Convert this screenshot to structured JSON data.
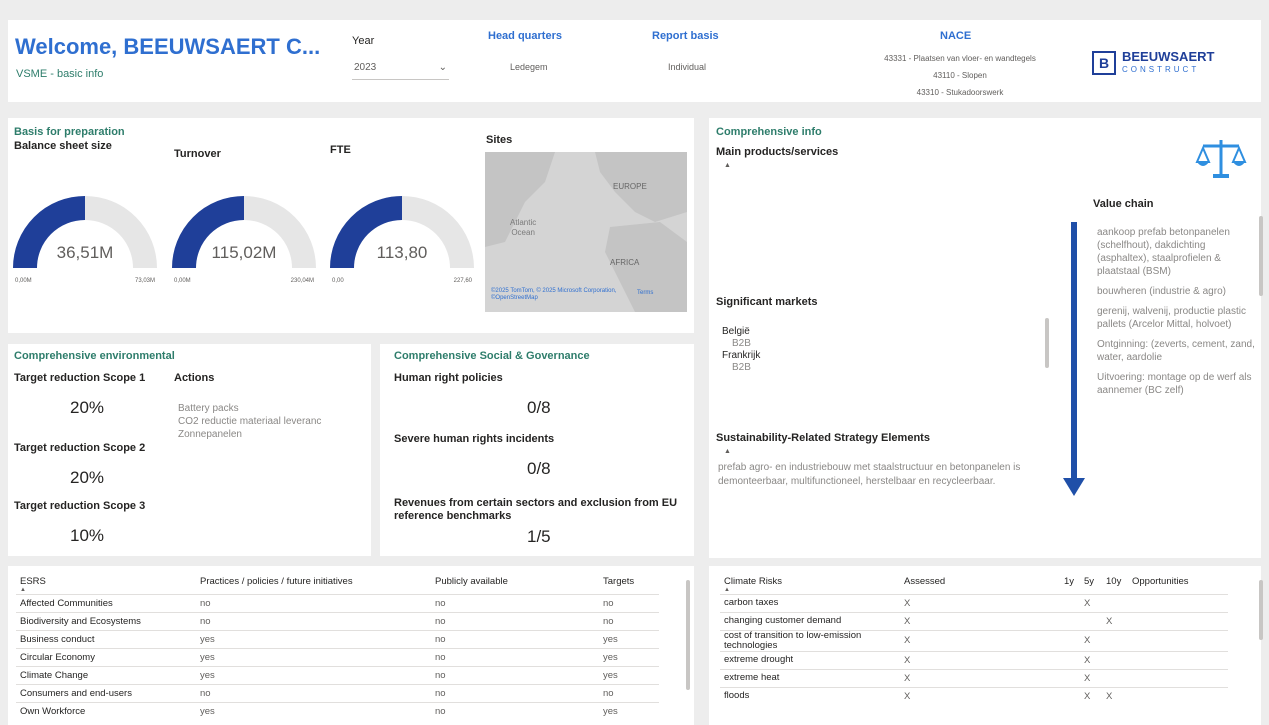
{
  "header": {
    "title": "Welcome, BEEUWSAERT C...",
    "subtitle": "VSME - basic info",
    "year_label": "Year",
    "year_value": "2023",
    "hq_label": "Head quarters",
    "hq_value": "Ledegem",
    "report_basis_label": "Report basis",
    "report_basis_value": "Individual",
    "nace_label": "NACE",
    "nace_values": [
      "43331 - Plaatsen van vloer- en wandtegels",
      "43110 - Slopen",
      "43310 - Stukadoorswerk"
    ],
    "logo_letter": "B",
    "logo_name": "BEEUWSAERT",
    "logo_sub": "CONSTRUCT"
  },
  "basis": {
    "title": "Basis for preparation",
    "sites_label": "Sites",
    "gauges": [
      {
        "label": "Balance sheet size",
        "value": "36,51M",
        "min": "0,00M",
        "max": "73,03M",
        "fraction": 0.5
      },
      {
        "label": "Turnover",
        "value": "115,02M",
        "min": "0,00M",
        "max": "230,04M",
        "fraction": 0.5
      },
      {
        "label": "FTE",
        "value": "113,80",
        "min": "0,00",
        "max": "227,60",
        "fraction": 0.5
      }
    ],
    "map_labels": {
      "europe": "EUROPE",
      "ocean_line1": "Atlantic",
      "ocean_line2": "Ocean",
      "africa": "AFRICA",
      "copyright": "©2025 TomTom, © 2025 Microsoft Corporation, ©OpenStreetMap",
      "terms": "Terms"
    }
  },
  "comprehensive_info": {
    "title": "Comprehensive info",
    "main_products_label": "Main products/services",
    "significant_markets_label": "Significant markets",
    "markets": [
      {
        "country": "België",
        "code": "B2B"
      },
      {
        "country": "Frankrijk",
        "code": "B2B"
      }
    ],
    "strategy_label": "Sustainability-Related Strategy Elements",
    "strategy_text": "prefab agro- en industriebouw met staalstructuur en betonpanelen is demonteerbaar, multifunctioneel, herstelbaar en recycleerbaar.",
    "value_chain_label": "Value chain",
    "value_chain": [
      "aankoop prefab betonpanelen (schelfhout), dakdichting (asphaltex), staalprofielen & plaatstaal (BSM)",
      "bouwheren (industrie & agro)",
      "gerenij, walvenij, productie plastic pallets (Arcelor Mittal, holvoet)",
      "Ontginning: (zeverts, cement, zand, water, aardolie",
      "Uitvoering: montage op de werf als aannemer (BC zelf)"
    ]
  },
  "environmental": {
    "title": "Comprehensive environmental",
    "scope1_label": "Target reduction Scope 1",
    "scope1_value": "20%",
    "scope2_label": "Target reduction Scope 2",
    "scope2_value": "20%",
    "scope3_label": "Target reduction Scope 3",
    "scope3_value": "10%",
    "actions_label": "Actions",
    "actions": [
      "Battery packs",
      "CO2 reductie materiaal leveranc",
      "Zonnepanelen"
    ]
  },
  "social": {
    "title": "Comprehensive Social & Governance",
    "hr_policies_label": "Human right policies",
    "hr_policies_value": "0/8",
    "severe_label": "Severe human rights incidents",
    "severe_value": "0/8",
    "revenues_label": "Revenues from certain sectors and exclusion from EU reference benchmarks",
    "revenues_value": "1/5"
  },
  "esrs_table": {
    "headers": [
      "ESRS",
      "Practices / policies / future initiatives",
      "Publicly available",
      "Targets"
    ],
    "rows": [
      [
        "Affected Communities",
        "no",
        "no",
        "no"
      ],
      [
        "Biodiversity and Ecosystems",
        "no",
        "no",
        "no"
      ],
      [
        "Business conduct",
        "yes",
        "no",
        "yes"
      ],
      [
        "Circular Economy",
        "yes",
        "no",
        "yes"
      ],
      [
        "Climate Change",
        "yes",
        "no",
        "yes"
      ],
      [
        "Consumers and end-users",
        "no",
        "no",
        "no"
      ],
      [
        "Own Workforce",
        "yes",
        "no",
        "yes"
      ]
    ]
  },
  "climate_table": {
    "headers": [
      "Climate Risks",
      "Assessed",
      "1y",
      "5y",
      "10y",
      "Opportunities"
    ],
    "rows": [
      [
        "carbon taxes",
        "X",
        "",
        "X",
        "",
        ""
      ],
      [
        "changing customer demand",
        "X",
        "",
        "",
        "X",
        ""
      ],
      [
        "cost of transition to low-emission technologies",
        "X",
        "",
        "X",
        "",
        ""
      ],
      [
        "extreme drought",
        "X",
        "",
        "X",
        "",
        ""
      ],
      [
        "extreme heat",
        "X",
        "",
        "X",
        "",
        ""
      ],
      [
        "floods",
        "X",
        "",
        "X",
        "X",
        ""
      ]
    ]
  },
  "colors": {
    "accent_blue": "#2f6fd0",
    "gauge_fill": "#1f3f99",
    "gauge_track": "#e6e6e6",
    "section_green": "#2e7d6b",
    "arrow": "#1f4fa8"
  }
}
